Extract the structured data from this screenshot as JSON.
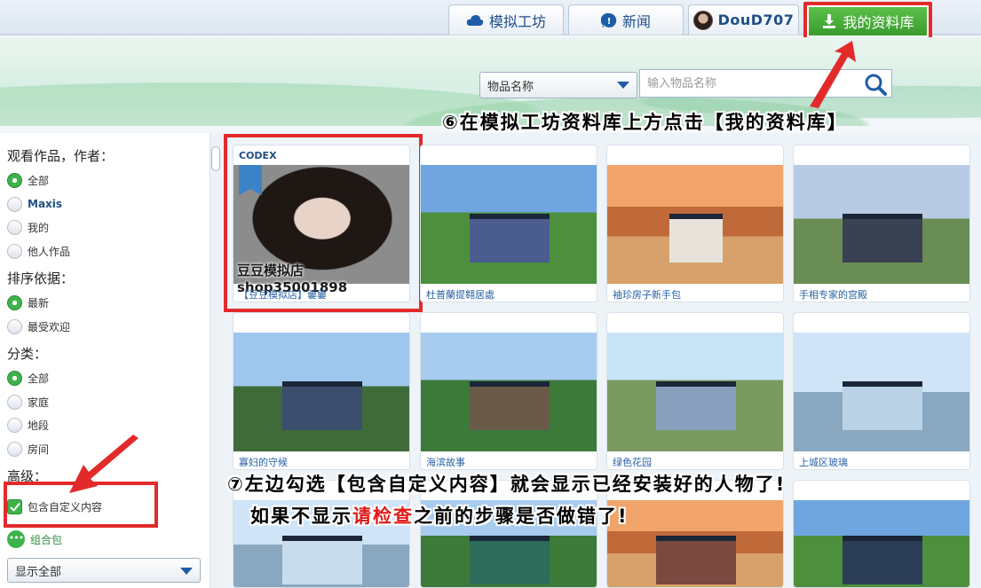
{
  "header": {
    "tabs": [
      {
        "label": "模拟工坊",
        "icon": "cloud-icon"
      },
      {
        "label": "新闻",
        "icon": "news-icon"
      },
      {
        "label": "DouD707",
        "icon": "avatar"
      },
      {
        "label": "我的资料库",
        "icon": "download-icon"
      }
    ]
  },
  "search": {
    "category_value": "物品名称",
    "placeholder": "输入物品名称"
  },
  "annotations": {
    "step6": "⑥在模拟工坊资料库上方点击【我的资料库】",
    "step7_line1": "⑦左边勾选【包含自定义内容】就会显示已经安装好的人物了!",
    "step7_line2_a": "如果不显示",
    "step7_line2_red": "请检查",
    "step7_line2_b": "之前的步骤是否做错了!"
  },
  "sidebar": {
    "view_by": {
      "heading": "观看作品，作者：",
      "options": [
        {
          "label": "全部",
          "selected": true
        },
        {
          "label": "Maxis",
          "selected": false
        },
        {
          "label": "我的",
          "selected": false
        },
        {
          "label": "他人作品",
          "selected": false
        }
      ]
    },
    "sort_by": {
      "heading": "排序依据：",
      "options": [
        {
          "label": "最新",
          "selected": true
        },
        {
          "label": "最受欢迎",
          "selected": false
        }
      ]
    },
    "category": {
      "heading": "分类：",
      "options": [
        {
          "label": "全部",
          "selected": true
        },
        {
          "label": "家庭",
          "selected": false
        },
        {
          "label": "地段",
          "selected": false
        },
        {
          "label": "房间",
          "selected": false
        }
      ]
    },
    "advanced": {
      "heading": "高级：",
      "include_cc": "包含自定义内容",
      "bundle": "组合包"
    },
    "show_select": "显示全部"
  },
  "grid": {
    "cards": [
      {
        "title": "【豆豆模拟店】嫑嫑",
        "badge": "CODEX",
        "watermark": "豆豆模拟店shop35001898"
      },
      {
        "title": "杜普蘭提翱居處"
      },
      {
        "title": "袖珍房子新手包"
      },
      {
        "title": "手相专家的宫殿"
      },
      {
        "title": "寡妇的守候"
      },
      {
        "title": "海滨故事"
      },
      {
        "title": "绿色花园"
      },
      {
        "title": "上城区玻璃"
      },
      {
        "title": ""
      },
      {
        "title": ""
      },
      {
        "title": ""
      },
      {
        "title": ""
      }
    ]
  },
  "colors": {
    "accent_green": "#3db34a",
    "highlight_red": "#e32a2a",
    "link_blue": "#2a62a6"
  }
}
